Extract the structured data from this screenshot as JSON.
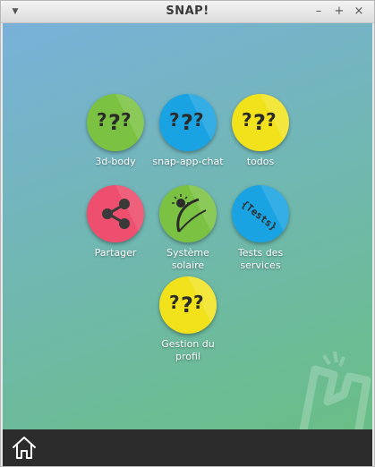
{
  "window": {
    "title": "SNAP!",
    "menu_icon": "triangle-down-icon",
    "min_label": "–",
    "max_label": "+",
    "close_label": "×"
  },
  "apps": [
    {
      "label": "3d-body",
      "color": "#7cc242",
      "icon": "question-marks-icon"
    },
    {
      "label": "snap-app-chat",
      "color": "#1aa3e2",
      "icon": "question-marks-icon"
    },
    {
      "label": "todos",
      "color": "#f2e21c",
      "icon": "question-marks-icon"
    },
    {
      "label": "Partager",
      "color": "#ee4f6e",
      "icon": "share-icon"
    },
    {
      "label": "Système solaire",
      "color": "#7cc242",
      "icon": "orbit-icon"
    },
    {
      "label": "Tests des services",
      "color": "#1aa3e2",
      "icon": "tests-brackets-icon"
    },
    {
      "label": "Gestion du profil",
      "color": "#f2e21c",
      "icon": "question-marks-icon"
    }
  ],
  "tests_icon_text": "{Tests}",
  "bottom_bar": {
    "home_icon": "home-icon"
  }
}
